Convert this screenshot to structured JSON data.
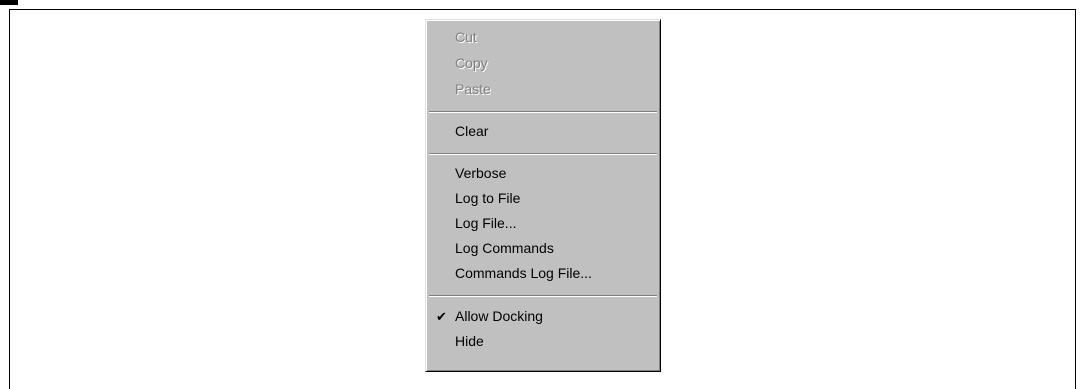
{
  "menu": {
    "items": [
      {
        "label": "Cut",
        "enabled": false
      },
      {
        "label": "Copy",
        "enabled": false
      },
      {
        "label": "Paste",
        "enabled": false
      },
      {
        "label": "Clear",
        "enabled": true
      },
      {
        "label": "Verbose",
        "enabled": true
      },
      {
        "label": "Log to File",
        "enabled": true
      },
      {
        "label": "Log File...",
        "enabled": true
      },
      {
        "label": "Log Commands",
        "enabled": true
      },
      {
        "label": "Commands Log File...",
        "enabled": true
      },
      {
        "label": "Allow Docking",
        "enabled": true,
        "checked": true
      },
      {
        "label": "Hide",
        "enabled": true
      }
    ],
    "check_glyph": "check-icon"
  },
  "colors": {
    "menu_bg": "#c0c0c0",
    "disabled_text": "#808080",
    "text": "#000000"
  }
}
